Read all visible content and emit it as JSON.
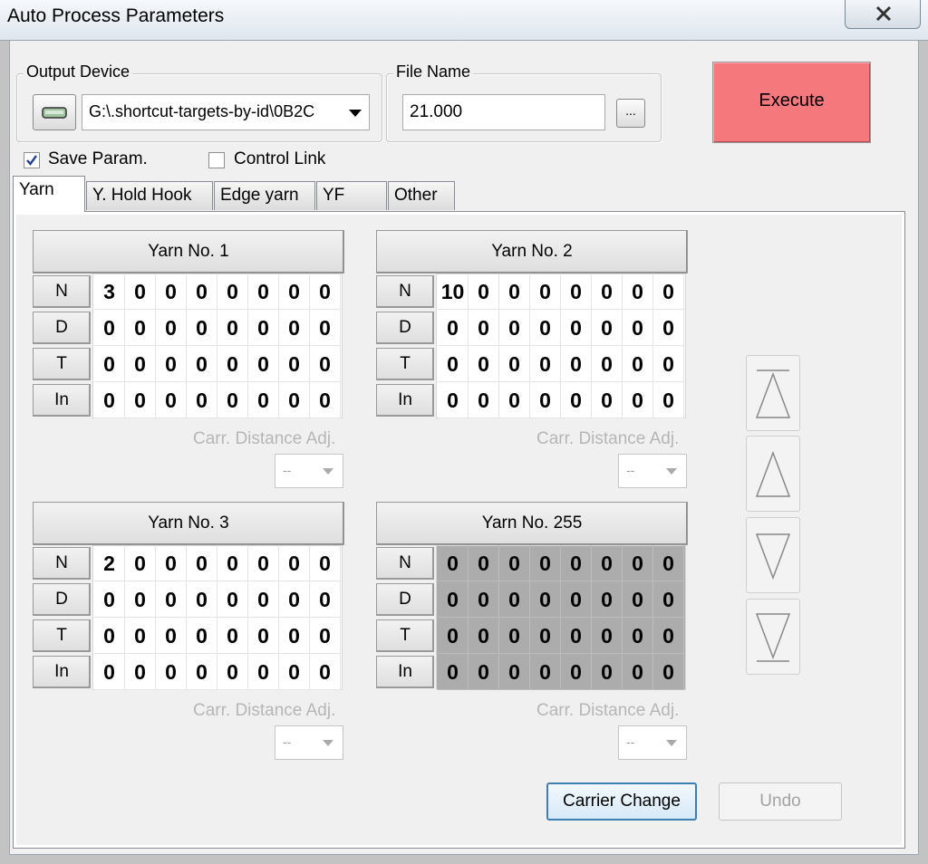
{
  "window": {
    "title": "Auto Process Parameters"
  },
  "output_device": {
    "group_label": "Output Device",
    "icon": "drive-icon",
    "path_value": "G:\\.shortcut-targets-by-id\\0B2C"
  },
  "file_name": {
    "group_label": "File Name",
    "value": "21.000",
    "browse_label": "..."
  },
  "execute_label": "Execute",
  "options": {
    "save_param": {
      "label": "Save Param.",
      "checked": true
    },
    "control_link": {
      "label": "Control Link",
      "checked": false
    }
  },
  "tabs": [
    {
      "label": "Yarn",
      "active": true
    },
    {
      "label": "Y. Hold Hook",
      "active": false
    },
    {
      "label": "Edge yarn",
      "active": false
    },
    {
      "label": "YF",
      "active": false
    },
    {
      "label": "Other",
      "active": false
    }
  ],
  "row_labels": [
    "N",
    "D",
    "T",
    "In"
  ],
  "yarns": [
    {
      "title": "Yarn No. 1",
      "rows": [
        [
          "3",
          "0",
          "0",
          "0",
          "0",
          "0",
          "0",
          "0"
        ],
        [
          "0",
          "0",
          "0",
          "0",
          "0",
          "0",
          "0",
          "0"
        ],
        [
          "0",
          "0",
          "0",
          "0",
          "0",
          "0",
          "0",
          "0"
        ],
        [
          "0",
          "0",
          "0",
          "0",
          "0",
          "0",
          "0",
          "0"
        ]
      ],
      "carr_label": "Carr. Distance Adj.",
      "carr_value": "--",
      "disabled": false
    },
    {
      "title": "Yarn No. 2",
      "rows": [
        [
          "10",
          "0",
          "0",
          "0",
          "0",
          "0",
          "0",
          "0"
        ],
        [
          "0",
          "0",
          "0",
          "0",
          "0",
          "0",
          "0",
          "0"
        ],
        [
          "0",
          "0",
          "0",
          "0",
          "0",
          "0",
          "0",
          "0"
        ],
        [
          "0",
          "0",
          "0",
          "0",
          "0",
          "0",
          "0",
          "0"
        ]
      ],
      "carr_label": "Carr. Distance Adj.",
      "carr_value": "--",
      "disabled": false
    },
    {
      "title": "Yarn No. 3",
      "rows": [
        [
          "2",
          "0",
          "0",
          "0",
          "0",
          "0",
          "0",
          "0"
        ],
        [
          "0",
          "0",
          "0",
          "0",
          "0",
          "0",
          "0",
          "0"
        ],
        [
          "0",
          "0",
          "0",
          "0",
          "0",
          "0",
          "0",
          "0"
        ],
        [
          "0",
          "0",
          "0",
          "0",
          "0",
          "0",
          "0",
          "0"
        ]
      ],
      "carr_label": "Carr. Distance Adj.",
      "carr_value": "--",
      "disabled": false
    },
    {
      "title": "Yarn No. 255",
      "rows": [
        [
          "0",
          "0",
          "0",
          "0",
          "0",
          "0",
          "0",
          "0"
        ],
        [
          "0",
          "0",
          "0",
          "0",
          "0",
          "0",
          "0",
          "0"
        ],
        [
          "0",
          "0",
          "0",
          "0",
          "0",
          "0",
          "0",
          "0"
        ],
        [
          "0",
          "0",
          "0",
          "0",
          "0",
          "0",
          "0",
          "0"
        ]
      ],
      "carr_label": "Carr. Distance Adj.",
      "carr_value": "--",
      "disabled": true
    }
  ],
  "navigation": [
    "move-to-top-icon",
    "move-up-icon",
    "move-down-icon",
    "move-to-bottom-icon"
  ],
  "actions": {
    "carrier_change_label": "Carrier Change",
    "undo_label": "Undo"
  },
  "colors": {
    "execute_bg": "#f5787c",
    "disabled_grid": "#acacac",
    "focus_border": "#3c7fb1"
  }
}
